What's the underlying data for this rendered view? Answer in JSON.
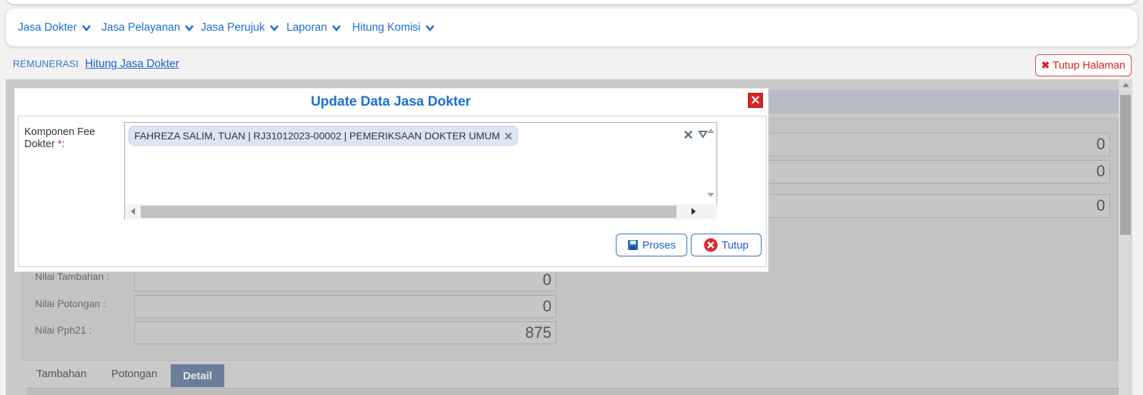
{
  "menu": [
    {
      "label": "Jasa Dokter"
    },
    {
      "label": "Jasa Pelayanan"
    },
    {
      "label": "Jasa Perujuk"
    },
    {
      "label": "Laporan"
    },
    {
      "label": "Hitung Komisi"
    }
  ],
  "breadcrumb": {
    "root": "REMUNERASI",
    "current": "Hitung Jasa Dokter"
  },
  "close_page_label": "Tutup Halaman",
  "background": {
    "fields_right": [
      "0",
      "0",
      "0"
    ],
    "labels": [
      "Nilai Tambahan :",
      "Nilai Potongan :",
      "Nilai Pph21 :"
    ],
    "values": [
      "0",
      "0",
      "875"
    ],
    "tabs": [
      "Tambahan",
      "Potongan",
      "Detail"
    ],
    "active_tab": "Detail"
  },
  "modal": {
    "title": "Update Data Jasa Dokter",
    "field_label": "Komponen Fee Dokter",
    "required_mark": "*",
    "field_label_suffix": ":",
    "selected_tag": "FAHREZA SALIM, TUAN | RJ31012023-00002 | PEMERIKSAAN DOKTER UMUM",
    "buttons": {
      "proses": "Proses",
      "tutup": "Tutup"
    }
  },
  "colors": {
    "accent": "#1a6fd6",
    "danger": "#e02020",
    "tab_active": "#6a7e99"
  }
}
